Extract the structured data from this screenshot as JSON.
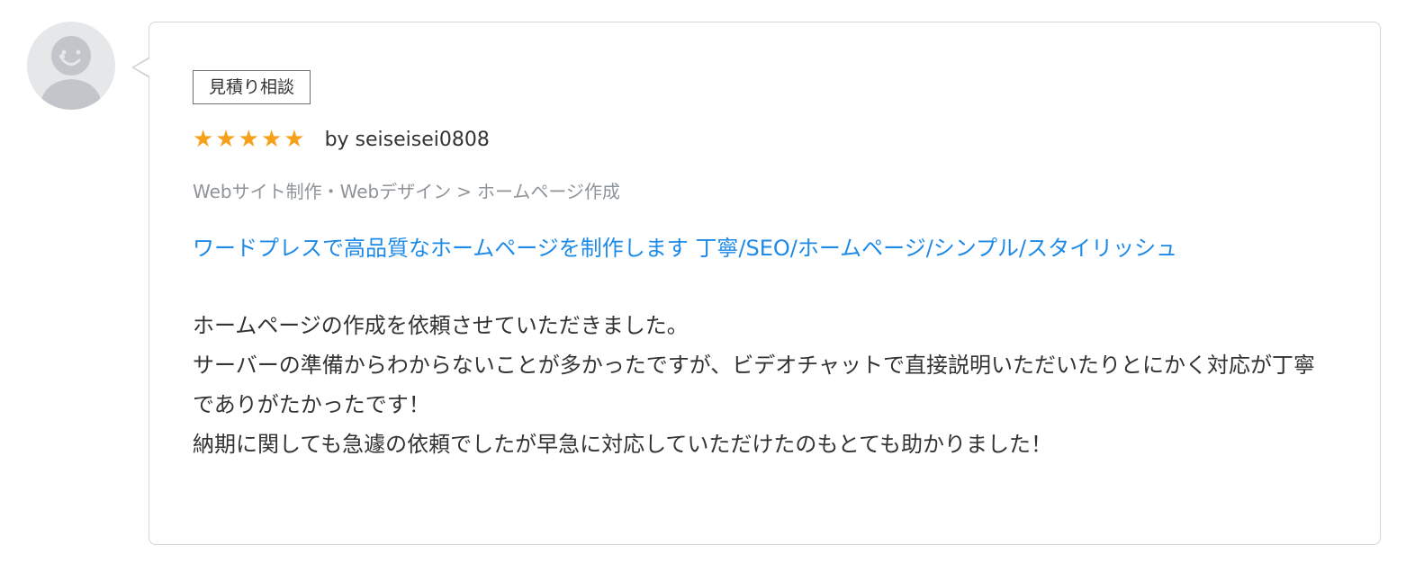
{
  "avatar": {
    "icon": "default-user-avatar-icon"
  },
  "review": {
    "tag_label": "見積り相談",
    "rating": 5,
    "rating_max": 5,
    "star_color": "#f7a11a",
    "reviewer": "by seiseisei0808",
    "category": {
      "parent": "Webサイト制作・Webデザイン",
      "separator": ">",
      "child": "ホームページ作成"
    },
    "service_title": "ワードプレスで高品質なホームページを制作します 丁寧/SEO/ホームページ/シンプル/スタイリッシュ",
    "link_color": "#1d8ae8",
    "body_lines": [
      "ホームページの作成を依頼させていただきました。",
      "サーバーの準備からわからないことが多かったですが、ビデオチャットで直接説明いただいたりとにかく対応が丁寧でありがたかったです！",
      "納期に関しても急遽の依頼でしたが早急に対応していただけたのもとても助かりました！"
    ]
  }
}
